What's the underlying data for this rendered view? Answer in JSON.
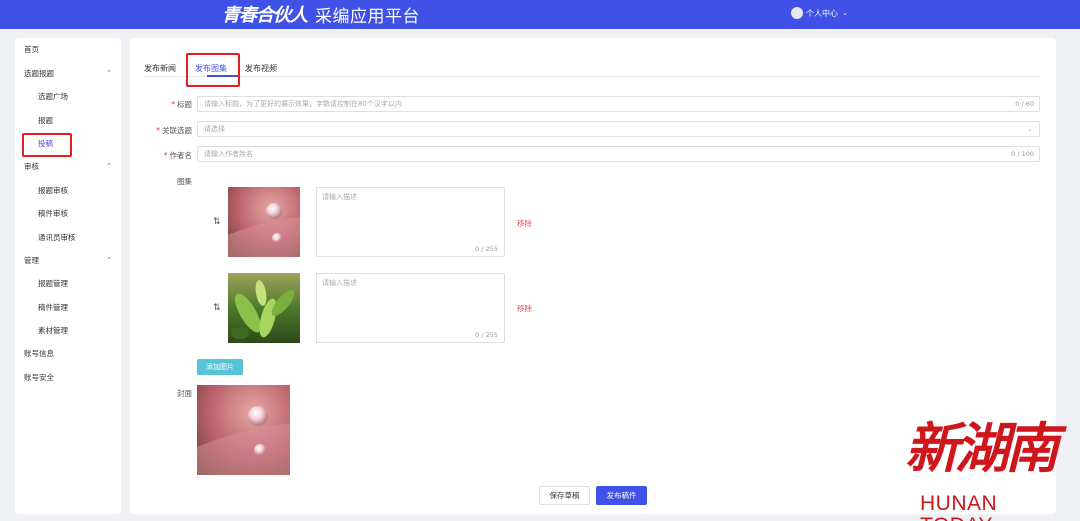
{
  "header": {
    "logo_script": "青春合伙人",
    "logo_title": "采编应用平台",
    "user_menu": "个人中心",
    "brand_color": "#3f51e6"
  },
  "sidebar": {
    "items": [
      {
        "label": "首页",
        "level": 1
      },
      {
        "label": "选题报题",
        "level": 1,
        "expand_icon": "chevron-up-icon"
      },
      {
        "label": "选题广场",
        "level": 2
      },
      {
        "label": "报题",
        "level": 2
      },
      {
        "label": "投稿",
        "level": 2,
        "active": true
      },
      {
        "label": "审核",
        "level": 1,
        "expand_icon": "chevron-up-icon"
      },
      {
        "label": "报题审核",
        "level": 2
      },
      {
        "label": "稿件审核",
        "level": 2
      },
      {
        "label": "通讯员审核",
        "level": 2
      },
      {
        "label": "管理",
        "level": 1,
        "expand_icon": "chevron-up-icon"
      },
      {
        "label": "报题管理",
        "level": 2
      },
      {
        "label": "稿件管理",
        "level": 2
      },
      {
        "label": "素材管理",
        "level": 2
      },
      {
        "label": "账号信息",
        "level": 1
      },
      {
        "label": "账号安全",
        "level": 1
      }
    ]
  },
  "tabs": [
    {
      "label": "发布新闻",
      "active": false
    },
    {
      "label": "发布图集",
      "active": true
    },
    {
      "label": "发布视频",
      "active": false
    }
  ],
  "form": {
    "title": {
      "label": "标题",
      "placeholder": "请输入标题，为了更好的展示效果，字数请控制在80个汉字以内",
      "count": "0 / 60"
    },
    "topic": {
      "label": "关联选题",
      "placeholder": "请选择"
    },
    "author": {
      "label": "作者名",
      "placeholder": "请输入作者姓名",
      "count": "0 / 100"
    },
    "gallery_label": "图集",
    "gallery": [
      {
        "image": "water-droplet-on-pink-petal",
        "desc_placeholder": "请输入描述",
        "count": "0 / 255",
        "remove": "移除"
      },
      {
        "image": "green-tea-leaves",
        "desc_placeholder": "请输入描述",
        "count": "0 / 255",
        "remove": "移除"
      }
    ],
    "add_image": "添加图片",
    "cover_label": "封面",
    "cover_image": "water-droplet-on-pink-petal"
  },
  "actions": {
    "save_draft": "保存草稿",
    "publish": "发布稿件"
  },
  "watermark": {
    "cn": "新湖南",
    "en": "HUNAN TODAY",
    "color": "#d0161d"
  },
  "annotation_color": "#e41f1f"
}
